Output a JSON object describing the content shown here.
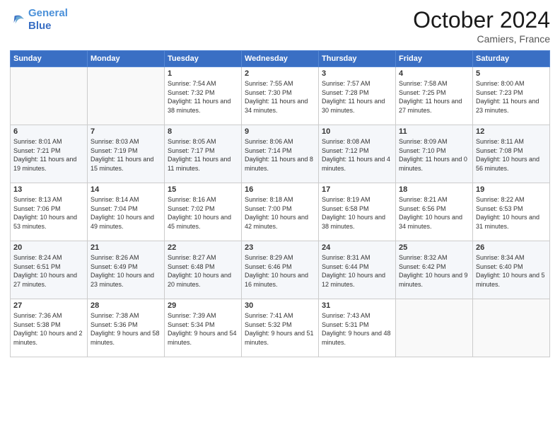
{
  "header": {
    "logo_line1": "General",
    "logo_line2": "Blue",
    "month": "October 2024",
    "location": "Camiers, France"
  },
  "weekdays": [
    "Sunday",
    "Monday",
    "Tuesday",
    "Wednesday",
    "Thursday",
    "Friday",
    "Saturday"
  ],
  "weeks": [
    [
      {
        "day": "",
        "content": ""
      },
      {
        "day": "",
        "content": ""
      },
      {
        "day": "1",
        "content": "Sunrise: 7:54 AM\nSunset: 7:32 PM\nDaylight: 11 hours and 38 minutes."
      },
      {
        "day": "2",
        "content": "Sunrise: 7:55 AM\nSunset: 7:30 PM\nDaylight: 11 hours and 34 minutes."
      },
      {
        "day": "3",
        "content": "Sunrise: 7:57 AM\nSunset: 7:28 PM\nDaylight: 11 hours and 30 minutes."
      },
      {
        "day": "4",
        "content": "Sunrise: 7:58 AM\nSunset: 7:25 PM\nDaylight: 11 hours and 27 minutes."
      },
      {
        "day": "5",
        "content": "Sunrise: 8:00 AM\nSunset: 7:23 PM\nDaylight: 11 hours and 23 minutes."
      }
    ],
    [
      {
        "day": "6",
        "content": "Sunrise: 8:01 AM\nSunset: 7:21 PM\nDaylight: 11 hours and 19 minutes."
      },
      {
        "day": "7",
        "content": "Sunrise: 8:03 AM\nSunset: 7:19 PM\nDaylight: 11 hours and 15 minutes."
      },
      {
        "day": "8",
        "content": "Sunrise: 8:05 AM\nSunset: 7:17 PM\nDaylight: 11 hours and 11 minutes."
      },
      {
        "day": "9",
        "content": "Sunrise: 8:06 AM\nSunset: 7:14 PM\nDaylight: 11 hours and 8 minutes."
      },
      {
        "day": "10",
        "content": "Sunrise: 8:08 AM\nSunset: 7:12 PM\nDaylight: 11 hours and 4 minutes."
      },
      {
        "day": "11",
        "content": "Sunrise: 8:09 AM\nSunset: 7:10 PM\nDaylight: 11 hours and 0 minutes."
      },
      {
        "day": "12",
        "content": "Sunrise: 8:11 AM\nSunset: 7:08 PM\nDaylight: 10 hours and 56 minutes."
      }
    ],
    [
      {
        "day": "13",
        "content": "Sunrise: 8:13 AM\nSunset: 7:06 PM\nDaylight: 10 hours and 53 minutes."
      },
      {
        "day": "14",
        "content": "Sunrise: 8:14 AM\nSunset: 7:04 PM\nDaylight: 10 hours and 49 minutes."
      },
      {
        "day": "15",
        "content": "Sunrise: 8:16 AM\nSunset: 7:02 PM\nDaylight: 10 hours and 45 minutes."
      },
      {
        "day": "16",
        "content": "Sunrise: 8:18 AM\nSunset: 7:00 PM\nDaylight: 10 hours and 42 minutes."
      },
      {
        "day": "17",
        "content": "Sunrise: 8:19 AM\nSunset: 6:58 PM\nDaylight: 10 hours and 38 minutes."
      },
      {
        "day": "18",
        "content": "Sunrise: 8:21 AM\nSunset: 6:56 PM\nDaylight: 10 hours and 34 minutes."
      },
      {
        "day": "19",
        "content": "Sunrise: 8:22 AM\nSunset: 6:53 PM\nDaylight: 10 hours and 31 minutes."
      }
    ],
    [
      {
        "day": "20",
        "content": "Sunrise: 8:24 AM\nSunset: 6:51 PM\nDaylight: 10 hours and 27 minutes."
      },
      {
        "day": "21",
        "content": "Sunrise: 8:26 AM\nSunset: 6:49 PM\nDaylight: 10 hours and 23 minutes."
      },
      {
        "day": "22",
        "content": "Sunrise: 8:27 AM\nSunset: 6:48 PM\nDaylight: 10 hours and 20 minutes."
      },
      {
        "day": "23",
        "content": "Sunrise: 8:29 AM\nSunset: 6:46 PM\nDaylight: 10 hours and 16 minutes."
      },
      {
        "day": "24",
        "content": "Sunrise: 8:31 AM\nSunset: 6:44 PM\nDaylight: 10 hours and 12 minutes."
      },
      {
        "day": "25",
        "content": "Sunrise: 8:32 AM\nSunset: 6:42 PM\nDaylight: 10 hours and 9 minutes."
      },
      {
        "day": "26",
        "content": "Sunrise: 8:34 AM\nSunset: 6:40 PM\nDaylight: 10 hours and 5 minutes."
      }
    ],
    [
      {
        "day": "27",
        "content": "Sunrise: 7:36 AM\nSunset: 5:38 PM\nDaylight: 10 hours and 2 minutes."
      },
      {
        "day": "28",
        "content": "Sunrise: 7:38 AM\nSunset: 5:36 PM\nDaylight: 9 hours and 58 minutes."
      },
      {
        "day": "29",
        "content": "Sunrise: 7:39 AM\nSunset: 5:34 PM\nDaylight: 9 hours and 54 minutes."
      },
      {
        "day": "30",
        "content": "Sunrise: 7:41 AM\nSunset: 5:32 PM\nDaylight: 9 hours and 51 minutes."
      },
      {
        "day": "31",
        "content": "Sunrise: 7:43 AM\nSunset: 5:31 PM\nDaylight: 9 hours and 48 minutes."
      },
      {
        "day": "",
        "content": ""
      },
      {
        "day": "",
        "content": ""
      }
    ]
  ]
}
